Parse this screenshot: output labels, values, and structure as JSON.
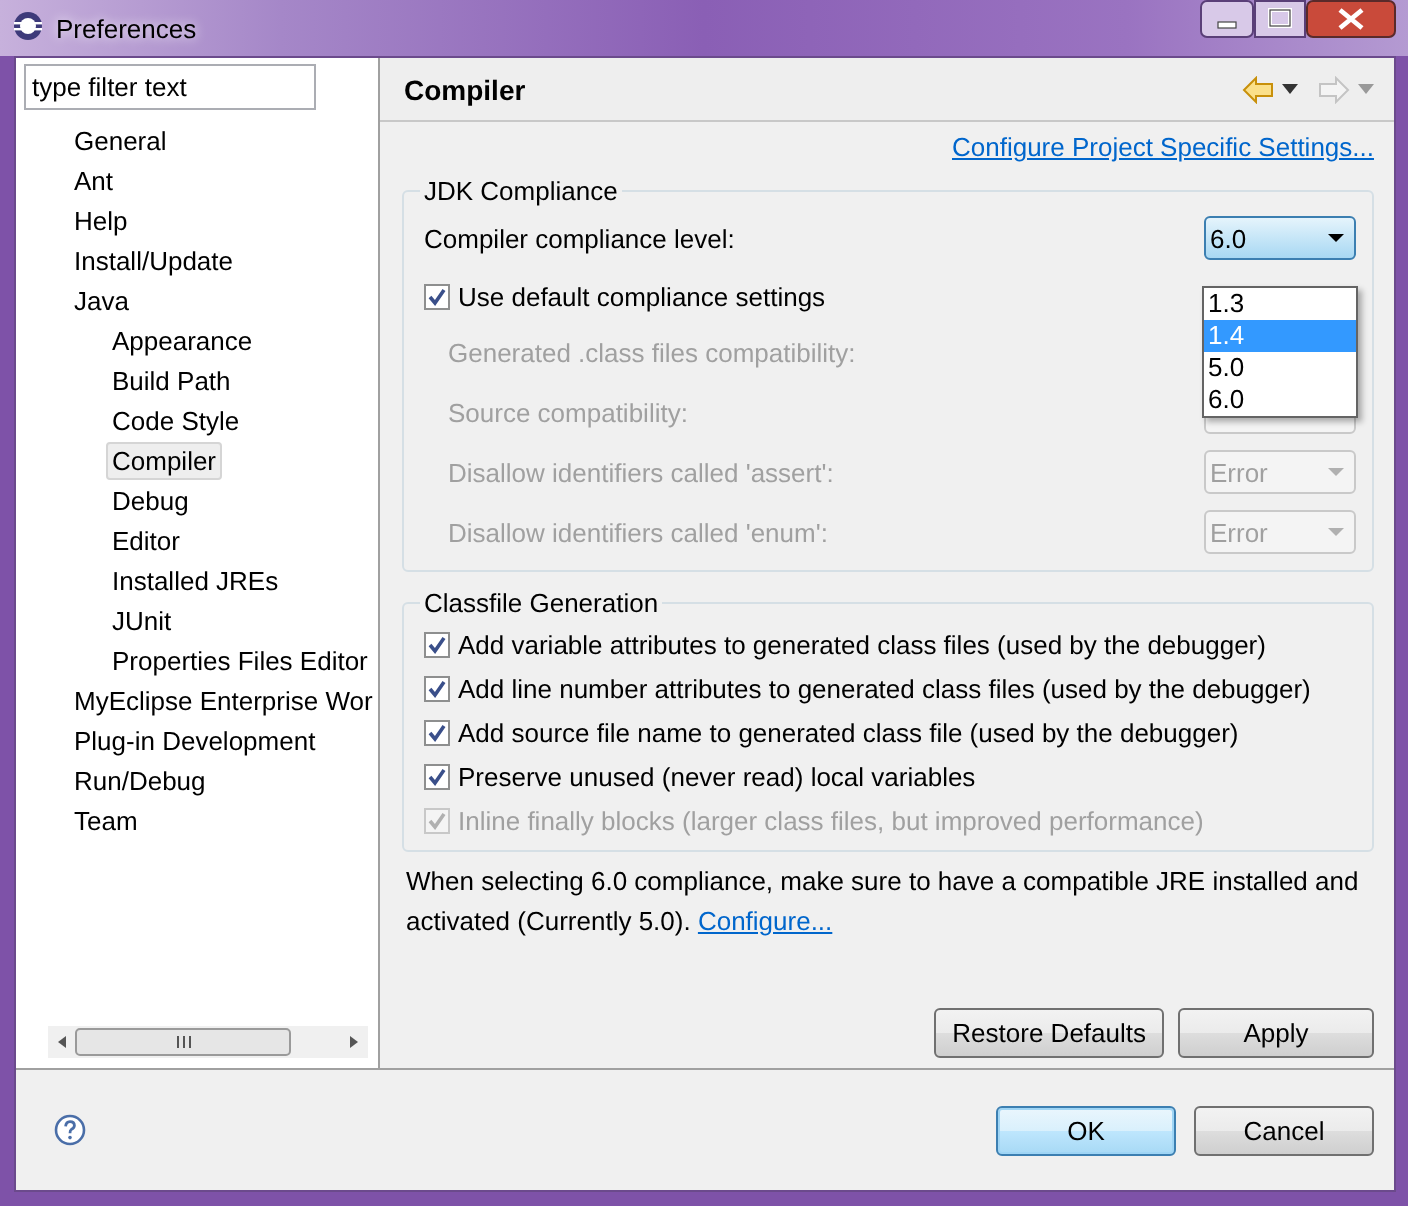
{
  "window": {
    "title": "Preferences"
  },
  "filter": {
    "placeholder": "type filter text"
  },
  "tree": [
    {
      "label": "General",
      "selected": false
    },
    {
      "label": "Ant",
      "selected": false
    },
    {
      "label": "Help",
      "selected": false
    },
    {
      "label": "Install/Update",
      "selected": false
    },
    {
      "label": "Java",
      "selected": false,
      "children": [
        {
          "label": "Appearance",
          "selected": false
        },
        {
          "label": "Build Path",
          "selected": false
        },
        {
          "label": "Code Style",
          "selected": false
        },
        {
          "label": "Compiler",
          "selected": true
        },
        {
          "label": "Debug",
          "selected": false
        },
        {
          "label": "Editor",
          "selected": false
        },
        {
          "label": "Installed JREs",
          "selected": false
        },
        {
          "label": "JUnit",
          "selected": false
        },
        {
          "label": "Properties Files Editor",
          "selected": false
        }
      ]
    },
    {
      "label": "MyEclipse Enterprise Wor",
      "selected": false
    },
    {
      "label": "Plug-in Development",
      "selected": false
    },
    {
      "label": "Run/Debug",
      "selected": false
    },
    {
      "label": "Team",
      "selected": false
    }
  ],
  "page": {
    "title": "Compiler",
    "link": "Configure Project Specific Settings..."
  },
  "jdk_compliance": {
    "title": "JDK Compliance",
    "compliance_label": "Compiler compliance level:",
    "compliance_value": "6.0",
    "dropdown_options": [
      {
        "label": "1.3",
        "selected": false
      },
      {
        "label": "1.4",
        "selected": true
      },
      {
        "label": "5.0",
        "selected": false
      },
      {
        "label": "6.0",
        "selected": false
      }
    ],
    "use_default": {
      "label": "Use default compliance settings",
      "checked": true
    },
    "settings": [
      {
        "label": "Generated .class files compatibility:",
        "disabled": true
      },
      {
        "label": "Source compatibility:",
        "disabled": true
      },
      {
        "label": "Disallow identifiers called 'assert':",
        "value": "Error",
        "disabled": true
      },
      {
        "label": "Disallow identifiers called 'enum':",
        "value": "Error",
        "disabled": true
      }
    ]
  },
  "classfile_generation": {
    "title": "Classfile Generation",
    "options": [
      {
        "label": "Add variable attributes to generated class files (used by the debugger)",
        "checked": true,
        "disabled": false
      },
      {
        "label": "Add line number attributes to generated class files (used by the debugger)",
        "checked": true,
        "disabled": false
      },
      {
        "label": "Add source file name to generated class file (used by the debugger)",
        "checked": true,
        "disabled": false
      },
      {
        "label": "Preserve unused (never read) local variables",
        "checked": true,
        "disabled": false
      },
      {
        "label": "Inline finally blocks (larger class files, but improved performance)",
        "checked": true,
        "disabled": true
      }
    ]
  },
  "note": {
    "text": "When selecting 6.0 compliance, make sure to have a compatible JRE installed and activated (Currently 5.0).",
    "link": "Configure..."
  },
  "page_buttons": [
    {
      "label": "Restore Defaults"
    },
    {
      "label": "Apply"
    }
  ],
  "dialog_buttons": [
    {
      "label": "OK",
      "default": true
    },
    {
      "label": "Cancel",
      "default": false
    }
  ]
}
